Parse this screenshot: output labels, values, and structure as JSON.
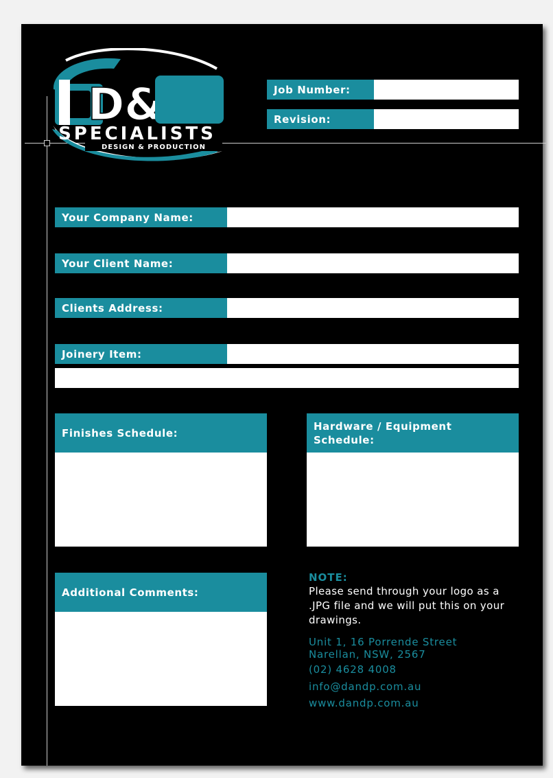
{
  "colors": {
    "accent": "#1a8d9e",
    "background": "#000000",
    "field": "#ffffff"
  },
  "logo": {
    "title": "D&P",
    "subtitle": "SPECIALISTS",
    "tagline": "DESIGN & PRODUCTION"
  },
  "header": {
    "job_number_label": "Job Number:",
    "job_number_value": "",
    "revision_label": "Revision:",
    "revision_value": ""
  },
  "form": {
    "company_label": "Your Company Name:",
    "company_value": "",
    "client_label": "Your Client Name:",
    "client_value": "",
    "address_label": "Clients Address:",
    "address_value": "",
    "joinery_label": "Joinery Item:",
    "joinery_value": "",
    "joinery_value_2": ""
  },
  "panels": {
    "finishes_label": "Finishes Schedule:",
    "hardware_label": "Hardware / Equipment Schedule:",
    "comments_label": "Additional Comments:"
  },
  "note": {
    "title": "NOTE:",
    "text": "Please send through your logo as a .JPG file and we will put this on your drawings."
  },
  "contact": {
    "address_line1": "Unit 1, 16 Porrende Street",
    "address_line2": "Narellan, NSW, 2567",
    "phone": "(02) 4628 4008",
    "email": "info@dandp.com.au",
    "website": "www.dandp.com.au"
  }
}
